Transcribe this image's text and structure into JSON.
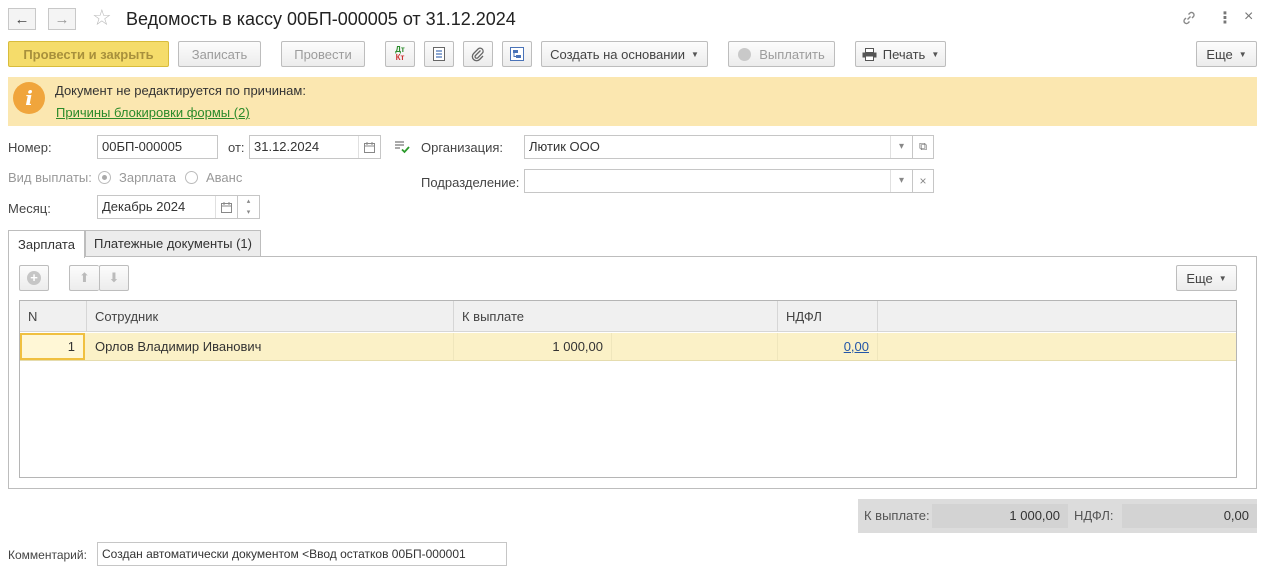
{
  "window": {
    "title": "Ведомость в кассу 00БП-000005 от 31.12.2024"
  },
  "toolbar": {
    "post_close": "Провести и закрыть",
    "save": "Записать",
    "post": "Провести",
    "dt_kt": "Дт Кт",
    "create_based_on": "Создать на основании",
    "pay": "Выплатить",
    "print": "Печать",
    "more": "Еще"
  },
  "banner": {
    "text": "Документ не редактируется по причинам:",
    "link": "Причины блокировки формы (2)"
  },
  "form": {
    "number_label": "Номер:",
    "number_value": "00БП-000005",
    "date_label": "от:",
    "date_value": "31.12.2024",
    "org_label": "Организация:",
    "org_value": "Лютик ООО",
    "payment_type_label": "Вид выплаты:",
    "payment_salary": "Зарплата",
    "payment_advance": "Аванс",
    "division_label": "Подразделение:",
    "division_value": "",
    "month_label": "Месяц:",
    "month_value": "Декабрь 2024"
  },
  "tabs": [
    {
      "label": "Зарплата",
      "active": true
    },
    {
      "label": "Платежные документы (1)",
      "active": false
    }
  ],
  "table": {
    "more": "Еще",
    "columns": [
      "N",
      "Сотрудник",
      "К выплате",
      "НДФЛ"
    ],
    "rows": [
      {
        "n": "1",
        "employee": "Орлов Владимир Иванович",
        "amount": "1 000,00",
        "ndfl": "0,00"
      }
    ]
  },
  "totals": {
    "amount_label": "К выплате:",
    "amount_value": "1 000,00",
    "ndfl_label": "НДФЛ:",
    "ndfl_value": "0,00"
  },
  "comment": {
    "label": "Комментарий:",
    "value": "Создан автоматически документом <Ввод остатков 00БП-000001"
  }
}
